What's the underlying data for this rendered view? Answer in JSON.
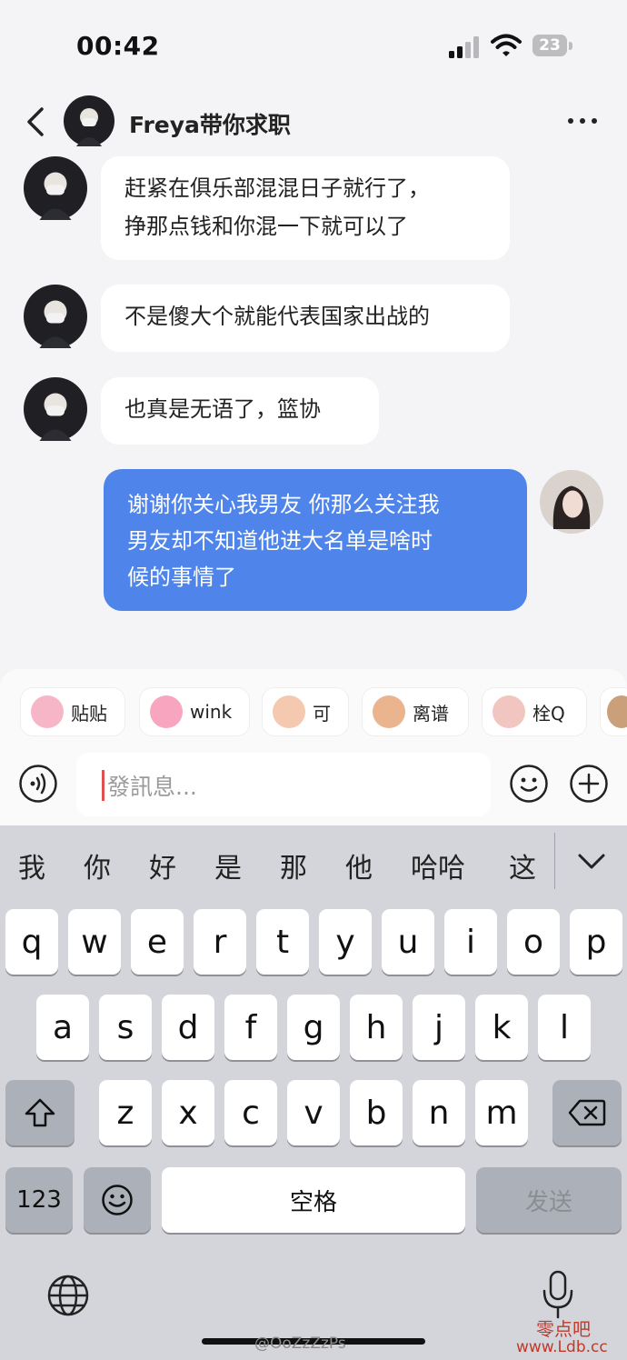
{
  "status_bar": {
    "time": "00:42",
    "battery": "23"
  },
  "header": {
    "title": "Freya带你求职"
  },
  "messages": [
    {
      "side": "in",
      "lines": [
        "赶紧在俱乐部混混日子就行了，",
        "挣那点钱和你混一下就可以了"
      ]
    },
    {
      "side": "in",
      "lines": [
        "不是傻大个就能代表国家出战的"
      ]
    },
    {
      "side": "in",
      "lines": [
        "也真是无语了，篮协"
      ]
    },
    {
      "side": "out",
      "lines": [
        "谢谢你关心我男友  你那么关注我",
        "男友却不知道他进大名单是啥时",
        "候的事情了"
      ]
    }
  ],
  "stickers": [
    {
      "label": "贴贴",
      "icon": "pink-bunny-hug-icon",
      "color": "#f6b6c8"
    },
    {
      "label": "wink",
      "icon": "pink-bunny-wink-icon",
      "color": "#f8a6c0"
    },
    {
      "label": "可",
      "icon": "bear-ok-icon",
      "color": "#f4c9b0"
    },
    {
      "label": "离谱",
      "icon": "facepalm-icon",
      "color": "#e9b48e"
    },
    {
      "label": "栓Q",
      "icon": "sweating-face-icon",
      "color": "#f2c6c0"
    }
  ],
  "input": {
    "placeholder": "發訊息..."
  },
  "keyboard": {
    "candidates": [
      "我",
      "你",
      "好",
      "是",
      "那",
      "他",
      "哈哈",
      "这"
    ],
    "row1": [
      "q",
      "w",
      "e",
      "r",
      "t",
      "y",
      "u",
      "i",
      "o",
      "p"
    ],
    "row2": [
      "a",
      "s",
      "d",
      "f",
      "g",
      "h",
      "j",
      "k",
      "l"
    ],
    "row3": [
      "z",
      "x",
      "c",
      "v",
      "b",
      "n",
      "m"
    ],
    "numbers_label": "123",
    "space_label": "空格",
    "send_label": "发送"
  },
  "watermark": "@OoZzZzPs",
  "site_logo": "零点吧",
  "site_url": "www.Ldb.cc",
  "colors": {
    "outgoing_bubble": "#4f85ea",
    "caret": "#e05050"
  }
}
